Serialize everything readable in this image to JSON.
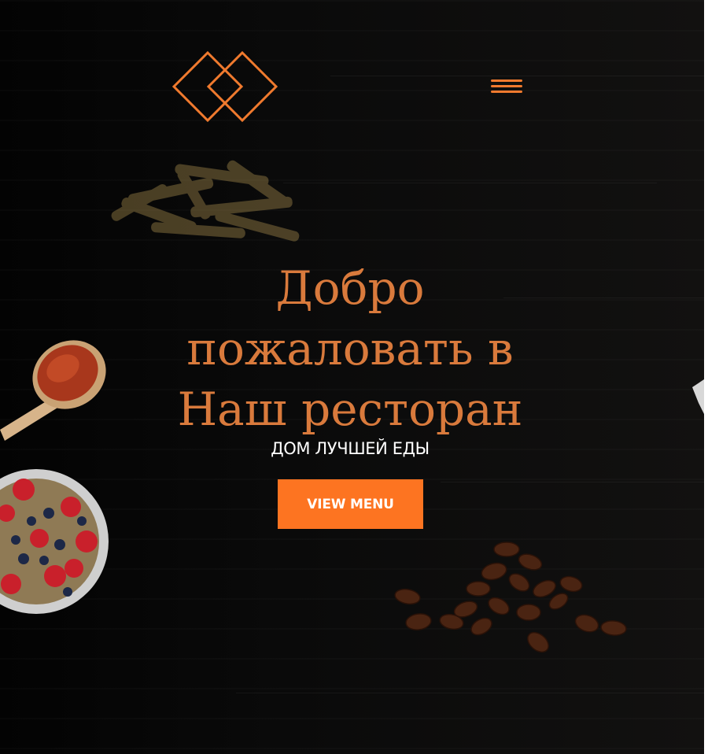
{
  "header": {
    "logo_icon": "interlocking-diamonds-logo",
    "menu_icon": "hamburger-icon"
  },
  "hero": {
    "title_lines": [
      "Добро",
      "пожаловать в",
      "Наш ресторан"
    ],
    "subtitle": "ДОМ ЛУЧШЕЙ ЕДЫ",
    "cta_label": "VIEW MENU"
  },
  "decor": {
    "images": [
      "french-fries-image",
      "spice-spoon-image",
      "berry-bowl-image",
      "coffee-beans-image"
    ]
  },
  "colors": {
    "accent": "#fd7421",
    "title": "#d97a3c",
    "background": "#080808",
    "subtitle": "#ffffff"
  }
}
